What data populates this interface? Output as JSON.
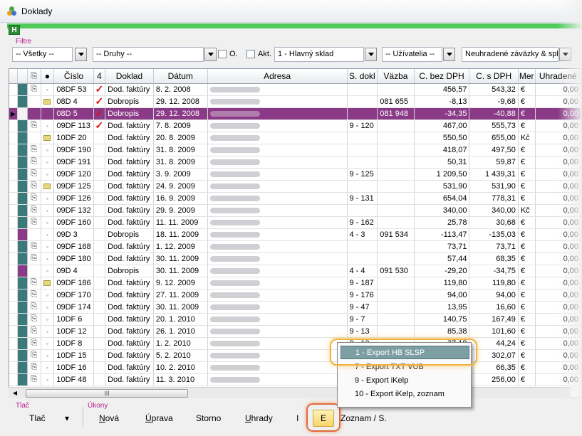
{
  "window": {
    "title": "Doklady"
  },
  "toolbar": {
    "h_label": "H"
  },
  "filters": {
    "section_label": "Filtre",
    "all": "-- Všetky --",
    "types": "-- Druhy --",
    "o_label": "O.",
    "akt_label": "Akt.",
    "warehouse": "1 - Hlavný sklad",
    "users": "-- Užívatelia --",
    "unpaid": "Neuhradené záväzky & spl"
  },
  "grid": {
    "columns": [
      "",
      "",
      "",
      "Číslo",
      "4",
      "Doklad",
      "Dátum",
      "Adresa",
      "S. dokl",
      "Väzba",
      "C. bez DPH",
      "C. s DPH",
      "Mer",
      "Uhradené"
    ],
    "rows": [
      {
        "marker": "#3a7a7a",
        "clip": true,
        "icon": "dot",
        "cislo": "08DF 53",
        "check": true,
        "doklad": "Dod. faktúry",
        "datum": "8. 2. 2008",
        "sdokl": "",
        "vazba": "",
        "bez": "456,57",
        "s": "543,32",
        "mer": "€",
        "uhr": "0,00"
      },
      {
        "marker": "#3a7a7a",
        "clip": false,
        "icon": "note",
        "cislo": "08D 4",
        "check": true,
        "doklad": "Dobropis",
        "datum": "29. 12. 2008",
        "sdokl": "",
        "vazba": "081 655",
        "bez": "-8,13",
        "s": "-9,68",
        "mer": "€",
        "uhr": "0,00"
      },
      {
        "marker": "#f4f4f4",
        "clip": false,
        "icon": "dot",
        "cislo": "08D 5",
        "check": true,
        "doklad": "Dobropis",
        "datum": "29. 12. 2008",
        "sdokl": "",
        "vazba": "081 948",
        "bez": "-34,35",
        "s": "-40,88",
        "mer": "€",
        "uhr": "0,00",
        "sel": true
      },
      {
        "marker": "#3a7a7a",
        "clip": true,
        "icon": "dot",
        "cislo": "09DF 113",
        "check": true,
        "doklad": "Dod. faktúry",
        "datum": "7. 8. 2009",
        "sdokl": "9 - 120",
        "vazba": "",
        "bez": "467,00",
        "s": "555,73",
        "mer": "€",
        "uhr": "0,00"
      },
      {
        "marker": "#3a7a7a",
        "clip": false,
        "icon": "note",
        "cislo": "10DF 20",
        "check": false,
        "doklad": "Dod. faktúry",
        "datum": "20. 8. 2009",
        "sdokl": "",
        "vazba": "",
        "bez": "550,50",
        "s": "655,00",
        "mer": "Kč",
        "uhr": "0,00"
      },
      {
        "marker": "#3a7a7a",
        "clip": true,
        "icon": "dot",
        "cislo": "09DF 190",
        "check": false,
        "doklad": "Dod. faktúry",
        "datum": "31. 8. 2009",
        "sdokl": "",
        "vazba": "",
        "bez": "418,07",
        "s": "497,50",
        "mer": "€",
        "uhr": "0,00"
      },
      {
        "marker": "#3a7a7a",
        "clip": true,
        "icon": "dot",
        "cislo": "09DF 191",
        "check": false,
        "doklad": "Dod. faktúry",
        "datum": "31. 8. 2009",
        "sdokl": "",
        "vazba": "",
        "bez": "50,31",
        "s": "59,87",
        "mer": "€",
        "uhr": "0,00"
      },
      {
        "marker": "#3a7a7a",
        "clip": true,
        "icon": "dot",
        "cislo": "09DF 120",
        "check": false,
        "doklad": "Dod. faktúry",
        "datum": "3. 9. 2009",
        "sdokl": "9 - 125",
        "vazba": "",
        "bez": "1 209,50",
        "s": "1 439,31",
        "mer": "€",
        "uhr": "0,00"
      },
      {
        "marker": "#3a7a7a",
        "clip": true,
        "icon": "note",
        "cislo": "09DF 125",
        "check": false,
        "doklad": "Dod. faktúry",
        "datum": "24. 9. 2009",
        "sdokl": "",
        "vazba": "",
        "bez": "531,90",
        "s": "531,90",
        "mer": "€",
        "uhr": "0,00"
      },
      {
        "marker": "#3a7a7a",
        "clip": true,
        "icon": "dot",
        "cislo": "09DF 126",
        "check": false,
        "doklad": "Dod. faktúry",
        "datum": "16. 9. 2009",
        "sdokl": "9 - 131",
        "vazba": "",
        "bez": "654,04",
        "s": "778,31",
        "mer": "€",
        "uhr": "0,00"
      },
      {
        "marker": "#3a7a7a",
        "clip": true,
        "icon": "dot",
        "cislo": "09DF 132",
        "check": false,
        "doklad": "Dod. faktúry",
        "datum": "29. 9. 2009",
        "sdokl": "",
        "vazba": "",
        "bez": "340,00",
        "s": "340,00",
        "mer": "Kč",
        "uhr": "0,00"
      },
      {
        "marker": "#3a7a7a",
        "clip": true,
        "icon": "dot",
        "cislo": "09DF 160",
        "check": false,
        "doklad": "Dod. faktúry",
        "datum": "11. 11. 2009",
        "sdokl": "9 - 162",
        "vazba": "",
        "bez": "25,78",
        "s": "30,68",
        "mer": "€",
        "uhr": "0,00"
      },
      {
        "marker": "#8a3a87",
        "clip": false,
        "icon": "dot",
        "cislo": "09D 3",
        "check": false,
        "doklad": "Dobropis",
        "datum": "18. 11. 2009",
        "sdokl": "4 - 3",
        "vazba": "091 534",
        "bez": "-113,47",
        "s": "-135,03",
        "mer": "€",
        "uhr": "0,00"
      },
      {
        "marker": "#3a7a7a",
        "clip": true,
        "icon": "dot",
        "cislo": "09DF 168",
        "check": false,
        "doklad": "Dod. faktúry",
        "datum": "1. 12. 2009",
        "sdokl": "",
        "vazba": "",
        "bez": "73,71",
        "s": "73,71",
        "mer": "€",
        "uhr": "0,00"
      },
      {
        "marker": "#3a7a7a",
        "clip": true,
        "icon": "dot",
        "cislo": "09DF 180",
        "check": false,
        "doklad": "Dod. faktúry",
        "datum": "30. 11. 2009",
        "sdokl": "",
        "vazba": "",
        "bez": "57,44",
        "s": "68,35",
        "mer": "€",
        "uhr": "0,00"
      },
      {
        "marker": "#8a3a87",
        "clip": false,
        "icon": "dot",
        "cislo": "09D 4",
        "check": false,
        "doklad": "Dobropis",
        "datum": "30. 11. 2009",
        "sdokl": "4 - 4",
        "vazba": "091 530",
        "bez": "-29,20",
        "s": "-34,75",
        "mer": "€",
        "uhr": "0,00"
      },
      {
        "marker": "#3a7a7a",
        "clip": true,
        "icon": "note",
        "cislo": "09DF 186",
        "check": false,
        "doklad": "Dod. faktúry",
        "datum": "9. 12. 2009",
        "sdokl": "9 - 187",
        "vazba": "",
        "bez": "119,80",
        "s": "119,80",
        "mer": "€",
        "uhr": "0,00"
      },
      {
        "marker": "#3a7a7a",
        "clip": true,
        "icon": "dot",
        "cislo": "09DF 170",
        "check": false,
        "doklad": "Dod. faktúry",
        "datum": "27. 11. 2009",
        "sdokl": "9 - 176",
        "vazba": "",
        "bez": "94,00",
        "s": "94,00",
        "mer": "€",
        "uhr": "0,00"
      },
      {
        "marker": "#3a7a7a",
        "clip": true,
        "icon": "dot",
        "cislo": "09DF 174",
        "check": false,
        "doklad": "Dod. faktúry",
        "datum": "30. 11. 2009",
        "sdokl": "9 - 47",
        "vazba": "",
        "bez": "13,95",
        "s": "16,60",
        "mer": "€",
        "uhr": "0,00"
      },
      {
        "marker": "#3a7a7a",
        "clip": true,
        "icon": "dot",
        "cislo": "10DF 6",
        "check": false,
        "doklad": "Dod. faktúry",
        "datum": "20. 1. 2010",
        "sdokl": "9 - 7",
        "vazba": "",
        "bez": "140,75",
        "s": "167,49",
        "mer": "€",
        "uhr": "0,00"
      },
      {
        "marker": "#3a7a7a",
        "clip": true,
        "icon": "dot",
        "cislo": "10DF 12",
        "check": false,
        "doklad": "Dod. faktúry",
        "datum": "26. 1. 2010",
        "sdokl": "9 - 13",
        "vazba": "",
        "bez": "85,38",
        "s": "101,60",
        "mer": "€",
        "uhr": "0,00"
      },
      {
        "marker": "#3a7a7a",
        "clip": true,
        "icon": "dot",
        "cislo": "10DF 8",
        "check": false,
        "doklad": "Dod. faktúry",
        "datum": "1. 2. 2010",
        "sdokl": "9 - 10",
        "vazba": "",
        "bez": "37,18",
        "s": "44,24",
        "mer": "€",
        "uhr": "0,00"
      },
      {
        "marker": "#3a7a7a",
        "clip": true,
        "icon": "dot",
        "cislo": "10DF 15",
        "check": false,
        "doklad": "Dod. faktúry",
        "datum": "5. 2. 2010",
        "sdokl": "",
        "vazba": "",
        "bez": "",
        "s": "302,07",
        "mer": "€",
        "uhr": "0,00"
      },
      {
        "marker": "#3a7a7a",
        "clip": true,
        "icon": "dot",
        "cislo": "10DF 16",
        "check": false,
        "doklad": "Dod. faktúry",
        "datum": "10. 2. 2010",
        "sdokl": "",
        "vazba": "",
        "bez": "",
        "s": "66,35",
        "mer": "€",
        "uhr": "0,00"
      },
      {
        "marker": "#3a7a7a",
        "clip": true,
        "icon": "dot",
        "cislo": "10DF 48",
        "check": false,
        "doklad": "Dod. faktúry",
        "datum": "11. 3. 2010",
        "sdokl": "",
        "vazba": "",
        "bez": "",
        "s": "256,00",
        "mer": "€",
        "uhr": "0,00"
      }
    ]
  },
  "scrollbar": {
    "thumb_grip": "III"
  },
  "bottom": {
    "print_label": "Tlač",
    "actions_label": "Úkony",
    "print_button": "Tlač",
    "new_prefix": "",
    "new_key": "N",
    "new_rest": "ová",
    "edit_prefix": "",
    "edit_key": "Ú",
    "edit_rest": "prava",
    "storno": "Storno",
    "payments_prefix": "",
    "payments_key": "U",
    "payments_rest": "hrady",
    "i_label": "I",
    "e_label": "E",
    "list_label": "Zoznam / S."
  },
  "export_menu": {
    "items": [
      "1 - Export HB SLSP",
      "7 - Export TXT VUB",
      "9 - Export iKelp",
      "10 - Export iKelp, zoznam"
    ]
  }
}
